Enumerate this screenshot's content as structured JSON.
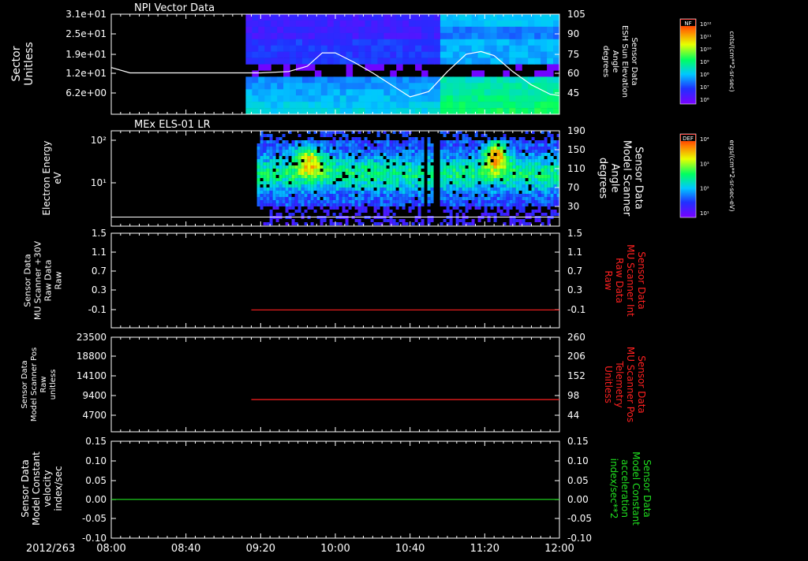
{
  "page": {
    "date_label": "2012/263"
  },
  "time_axis": {
    "start": "08:00",
    "end": "12:00",
    "tick_labels": [
      "08:00",
      "08:40",
      "09:20",
      "10:00",
      "10:40",
      "11:20",
      "12:00"
    ]
  },
  "colors": {
    "background": "#000000",
    "axes": "#ffffff",
    "red_trace": "#ff2020",
    "green_trace": "#20e020"
  },
  "panels": [
    {
      "id": "npi",
      "title": "NPI Vector Data",
      "left_label": [
        "Sector",
        "Unitless"
      ],
      "left_ticks": [
        "3.1e+01",
        "2.5e+01",
        "1.9e+01",
        "1.2e+01",
        "6.2e+00"
      ],
      "right_ticks": [
        "105",
        "90",
        "75",
        "60",
        "45"
      ],
      "right_label": [
        "Sensor Data",
        "ESH Sun Elevation",
        "Angle",
        "degrees"
      ],
      "colorbar": {
        "tag": "NF",
        "unit": "cnts/(cm**2-sr-sec)",
        "labels": [
          "10¹²",
          "10¹¹",
          "10¹⁰",
          "10⁹",
          "10⁸",
          "10⁷",
          "10⁶"
        ]
      }
    },
    {
      "id": "els",
      "title": "MEx ELS-01 LR",
      "left_label": [
        "Electron Energy",
        "eV"
      ],
      "left_ticks": [
        "10²",
        "10¹"
      ],
      "right_ticks": [
        "190",
        "150",
        "110",
        "70",
        "30"
      ],
      "right_label": [
        "Sensor Data",
        "Model Scanner",
        "Angle",
        "degrees"
      ],
      "colorbar": {
        "tag": "DEF",
        "unit": "ergs/(cm**2-sr-sec-eV)",
        "labels": [
          "10⁴",
          "10³",
          "10²",
          "10¹"
        ]
      }
    },
    {
      "id": "mu30",
      "left_label": [
        "Sensor Data",
        "MU Scanner +30V",
        "Raw Data",
        "Raw"
      ],
      "left_ticks": [
        "1.5",
        "1.1",
        "0.7",
        "0.3",
        "-0.1"
      ],
      "right_ticks": [
        "1.5",
        "1.1",
        "0.7",
        "0.3",
        "-0.1"
      ],
      "right_label": [
        "Sensor Data",
        "MU Scanner Int",
        "Raw Data",
        "Raw"
      ]
    },
    {
      "id": "scanpos",
      "left_label": [
        "Sensor Data",
        "Model Scanner Pos",
        "Raw",
        "unitless"
      ],
      "left_ticks": [
        "23500",
        "18800",
        "14100",
        "9400",
        "4700"
      ],
      "right_ticks": [
        "260",
        "206",
        "152",
        "98",
        "44"
      ],
      "right_label": [
        "Sensor Data",
        "MU Scanner Pos",
        "Telemetry",
        "Unitless"
      ]
    },
    {
      "id": "velocity",
      "left_label": [
        "Sensor Data",
        "Model Constant",
        "velocity",
        "index/sec"
      ],
      "left_ticks": [
        "0.15",
        "0.10",
        "0.05",
        "0.00",
        "-0.05",
        "-0.10"
      ],
      "right_ticks": [
        "0.15",
        "0.10",
        "0.05",
        "0.00",
        "-0.05",
        "-0.10"
      ],
      "right_label": [
        "Sensor Data",
        "Model Constant",
        "acceleration",
        "index/sec**2"
      ]
    }
  ],
  "chart_data": [
    {
      "type": "heatmap",
      "title": "NPI Vector Data",
      "ylabel": "Sector Unitless",
      "y2label": "Sensor Data ESH Sun Elevation Angle degrees",
      "data_start": "09:12",
      "overlay_series": {
        "name": "ESH Sun Elevation",
        "x": [
          "08:00",
          "08:10",
          "08:20",
          "08:40",
          "09:20",
          "09:35",
          "09:45",
          "09:53",
          "10:00",
          "10:10",
          "10:20",
          "10:30",
          "10:40",
          "10:50",
          "11:00",
          "11:10",
          "11:18",
          "11:25",
          "11:35",
          "11:45",
          "11:55",
          "12:00"
        ],
        "y": [
          65,
          61,
          61,
          61,
          61,
          62,
          66,
          76,
          76,
          69,
          61,
          52,
          43,
          47,
          62,
          75,
          77,
          74,
          62,
          52,
          45,
          44
        ]
      }
    },
    {
      "type": "heatmap",
      "title": "MEx ELS-01 LR",
      "ylabel": "Electron Energy eV",
      "y2label": "Sensor Data Model Scanner Angle degrees",
      "data_start": "09:18",
      "overlay_series": {
        "name": "Model Scanner Angle",
        "x": [
          "08:00",
          "12:00"
        ],
        "y": [
          18,
          18
        ]
      }
    },
    {
      "type": "line",
      "ylabel": "Sensor Data MU Scanner +30V Raw Data Raw",
      "y2label": "Sensor Data MU Scanner Int Raw Data Raw",
      "ylim": [
        -0.35,
        1.5
      ],
      "series": [
        {
          "name": "MU Scanner Int",
          "color": "#ff2020",
          "x": [
            "09:15",
            "12:00"
          ],
          "y": [
            0.0,
            0.0
          ]
        }
      ]
    },
    {
      "type": "line",
      "ylabel": "Sensor Data Model Scanner Pos Raw unitless",
      "y2label": "Sensor Data MU Scanner Pos Telemetry Unitless",
      "ylim": [
        0,
        23500
      ],
      "series": [
        {
          "name": "MU Scanner Pos",
          "color": "#ff2020",
          "x": [
            "09:15",
            "12:00"
          ],
          "y": [
            8000,
            8000
          ]
        }
      ]
    },
    {
      "type": "line",
      "ylabel": "Sensor Data Model Constant velocity index/sec",
      "y2label": "Sensor Data Model Constant acceleration index/sec**2",
      "ylim": [
        -0.1,
        0.15
      ],
      "series": [
        {
          "name": "Model Constant acceleration",
          "color": "#20e020",
          "x": [
            "08:00",
            "12:00"
          ],
          "y": [
            0.0,
            0.0
          ]
        }
      ]
    }
  ]
}
